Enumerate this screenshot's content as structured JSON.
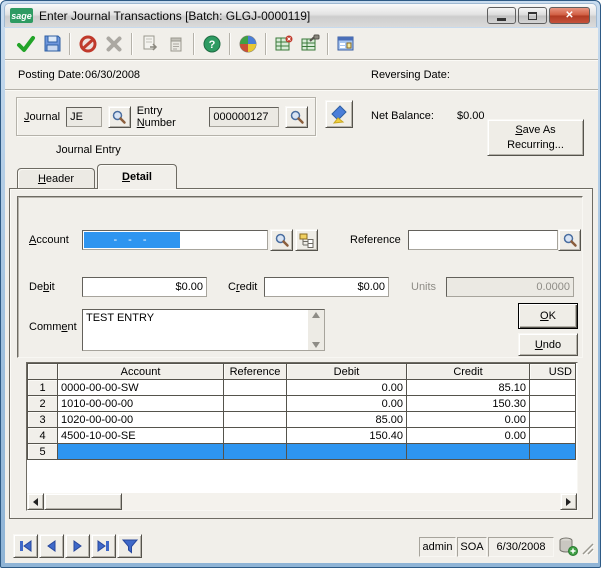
{
  "colors": {
    "selection_blue": "#2E95F0",
    "sage_green": "#2E9B62",
    "close_button_red": "#B03A22",
    "client_background": "#F1EFEA",
    "window_frame_blue": "#9FC0DE"
  },
  "window": {
    "logo_text": "sage",
    "title": "Enter Journal Transactions [Batch: GLGJ-0000119]"
  },
  "toolbar": {
    "icons": [
      "accept",
      "save",
      "cancel",
      "delete",
      "copy",
      "notes",
      "help",
      "currency",
      "export-excel",
      "excel-tools",
      "customize"
    ]
  },
  "form": {
    "posting_date_label": "Posting Date:",
    "posting_date_value": "06/30/2008",
    "reversing_date_label": "Reversing Date:",
    "journal_label": "Journal",
    "journal_value": "JE",
    "entry_number_label": "Entry Number",
    "entry_number_value": "000000127",
    "net_balance_label": "Net Balance:",
    "net_balance_value": "$0.00",
    "save_as_recurring_label": "Save As Recurring...",
    "journal_type_caption": "Journal Entry"
  },
  "tabs": {
    "header_label": "Header",
    "detail_label": "Detail",
    "active": "Detail"
  },
  "detail": {
    "account_label": "Account",
    "account_selected_text": "- - -",
    "reference_label": "Reference",
    "reference_value": "",
    "debit_label": "Debit",
    "debit_value": "$0.00",
    "credit_label": "Credit",
    "credit_value": "$0.00",
    "units_label": "Units",
    "units_value": "0.0000",
    "comment_label": "Comment",
    "comment_value": "TEST ENTRY",
    "ok_label": "OK",
    "undo_label": "Undo"
  },
  "grid": {
    "columns": {
      "row": "",
      "account": "Account",
      "reference": "Reference",
      "debit": "Debit",
      "credit": "Credit",
      "usd": "USD"
    },
    "rows": [
      {
        "num": "1",
        "account": "0000-00-00-SW",
        "reference": "",
        "debit": "0.00",
        "credit": "85.10",
        "usd": ""
      },
      {
        "num": "2",
        "account": "1010-00-00-00",
        "reference": "",
        "debit": "0.00",
        "credit": "150.30",
        "usd": ""
      },
      {
        "num": "3",
        "account": "1020-00-00-00",
        "reference": "",
        "debit": "85.00",
        "credit": "0.00",
        "usd": ""
      },
      {
        "num": "4",
        "account": "4500-10-00-SE",
        "reference": "",
        "debit": "150.40",
        "credit": "0.00",
        "usd": ""
      },
      {
        "num": "5",
        "account": "",
        "reference": "",
        "debit": "",
        "credit": "",
        "usd": ""
      }
    ],
    "selected_row": 5
  },
  "statusbar": {
    "user": "admin",
    "company": "SOA",
    "date": "6/30/2008"
  }
}
